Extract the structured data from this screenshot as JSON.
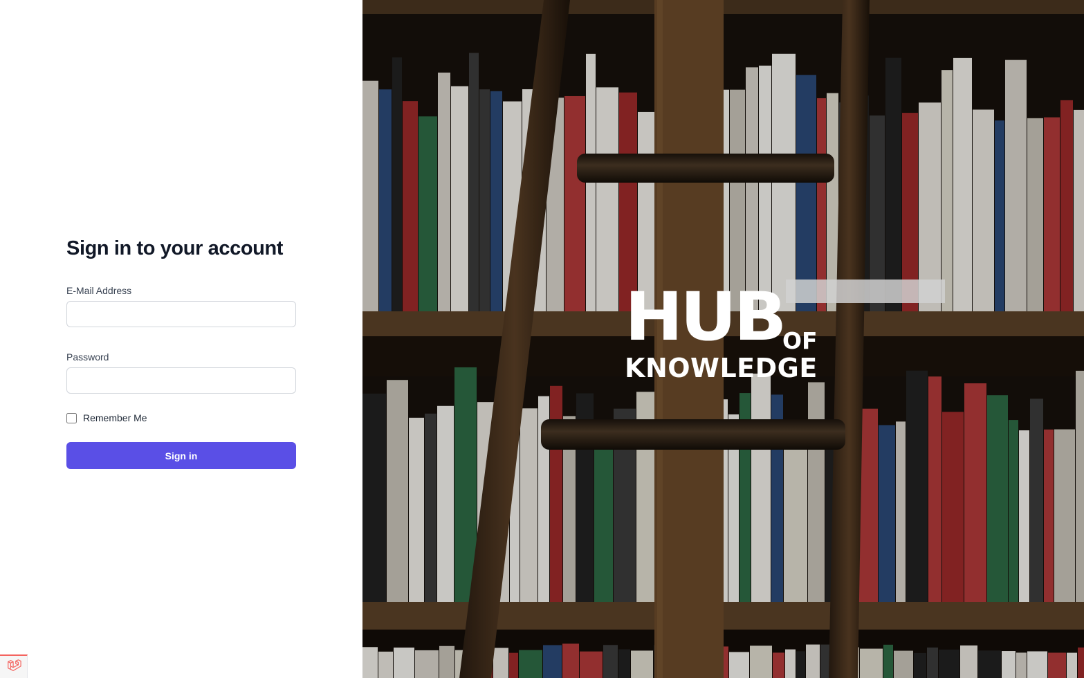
{
  "auth": {
    "title": "Sign in to your account",
    "email_label": "E-Mail Address",
    "email_value": "",
    "password_label": "Password",
    "password_value": "",
    "remember_label": "Remember Me",
    "remember_checked": false,
    "submit_label": "Sign in"
  },
  "brand": {
    "line1": "HUB",
    "line1_suffix": "OF",
    "line2": "KNOWLEDGE"
  },
  "colors": {
    "primary_button": "#5a4fe6",
    "title_text": "#111827",
    "debug_accent": "#f4645f"
  },
  "icons": {
    "debug_badge": "laravel-logo-icon"
  }
}
